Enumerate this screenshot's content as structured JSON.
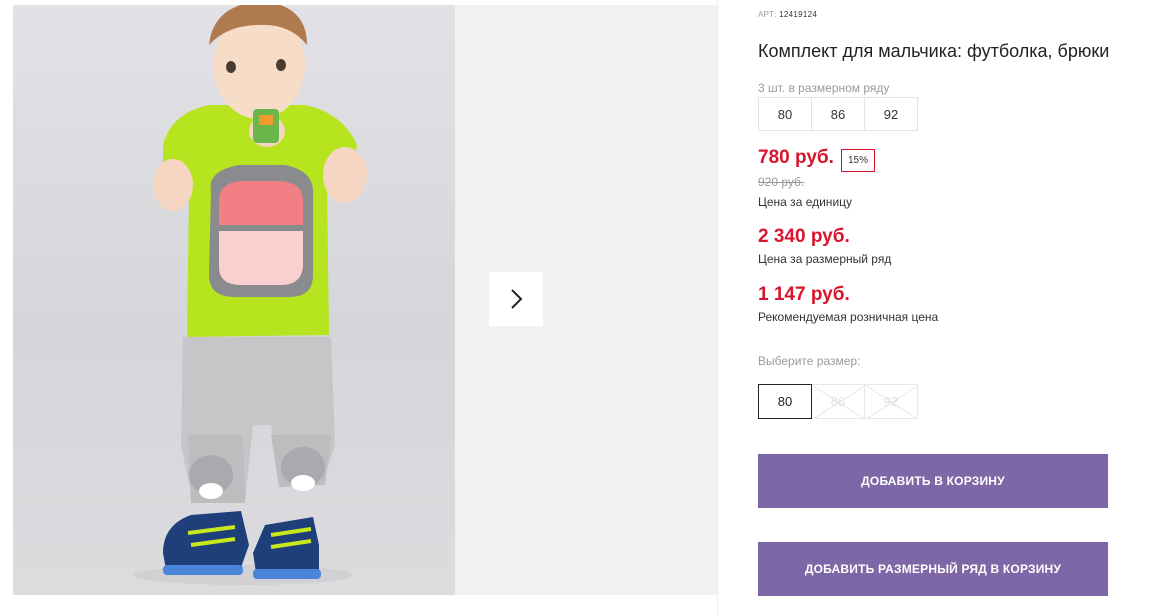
{
  "product": {
    "art_label": "АРТ:",
    "art_number": "12419124",
    "title": "Комплект для мальчика: футболка, брюки",
    "size_row_label": "3 шт. в размерном ряду",
    "size_row": [
      "80",
      "86",
      "92"
    ]
  },
  "pricing": {
    "unit_price": "780 руб.",
    "discount": "15%",
    "old_price": "920 руб.",
    "unit_caption": "Цена за единицу",
    "row_price": "2 340 руб.",
    "row_caption": "Цена за размерный ряд",
    "retail_price": "1 147 руб.",
    "retail_caption": "Рекомендуемая розничная цена"
  },
  "size_select": {
    "label": "Выберите размер:",
    "options": [
      {
        "value": "80",
        "available": true,
        "selected": true
      },
      {
        "value": "86",
        "available": false,
        "selected": false
      },
      {
        "value": "92",
        "available": false,
        "selected": false
      }
    ]
  },
  "actions": {
    "add_to_cart": "ДОБАВИТЬ В КОРЗИНУ",
    "add_row_to_cart": "ДОБАВИТЬ РАЗМЕРНЫЙ РЯД В КОРЗИНУ"
  },
  "gallery": {
    "next_icon": "chevron-right-icon"
  },
  "colors": {
    "price_red": "#d7152d",
    "button_purple": "#7d67a6"
  }
}
